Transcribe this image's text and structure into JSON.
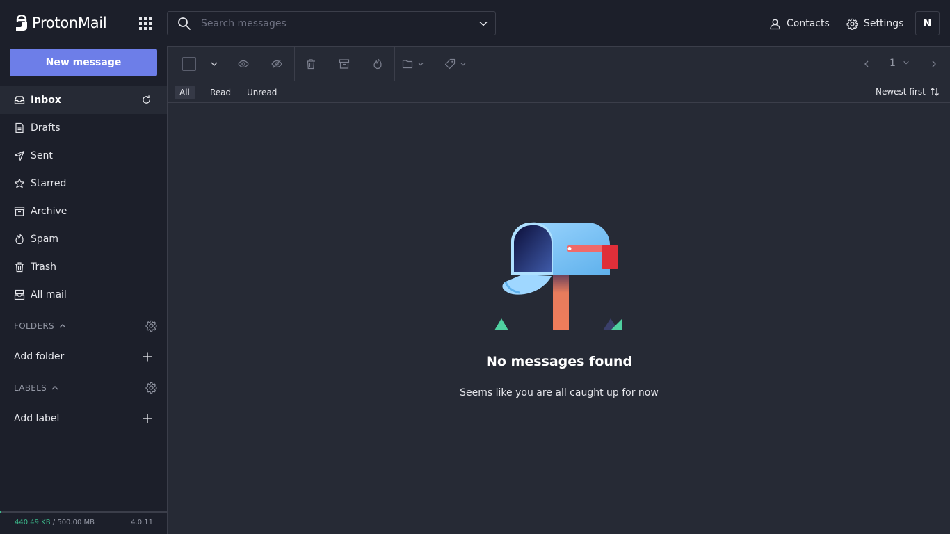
{
  "app": {
    "logo_text": "ProtonMail"
  },
  "search": {
    "placeholder": "Search messages"
  },
  "header": {
    "contacts_label": "Contacts",
    "settings_label": "Settings",
    "avatar_initial": "N"
  },
  "sidebar": {
    "new_message_label": "New message",
    "items": [
      {
        "label": "Inbox",
        "icon": "inbox-icon",
        "active": true
      },
      {
        "label": "Drafts",
        "icon": "drafts-icon"
      },
      {
        "label": "Sent",
        "icon": "paper-plane-icon"
      },
      {
        "label": "Starred",
        "icon": "star-icon"
      },
      {
        "label": "Archive",
        "icon": "archive-icon"
      },
      {
        "label": "Spam",
        "icon": "fire-icon"
      },
      {
        "label": "Trash",
        "icon": "trash-icon"
      },
      {
        "label": "All mail",
        "icon": "all-mail-icon"
      }
    ],
    "folders_label": "FOLDERS",
    "add_folder_label": "Add folder",
    "labels_label": "LABELS",
    "add_label_label": "Add label",
    "storage_used": "440.49 KB",
    "storage_total": "/ 500.00 MB",
    "storage_fraction": 0.0009,
    "version": "4.0.11"
  },
  "toolbar": {
    "page_number": "1"
  },
  "filters": {
    "all": "All",
    "read": "Read",
    "unread": "Unread",
    "sort_label": "Newest first"
  },
  "empty_state": {
    "title": "No messages found",
    "subtitle": "Seems like you are all caught up for now"
  },
  "colors": {
    "accent": "#6d7ee8",
    "background": "#1c1f2a",
    "panel": "#262a35",
    "storage_green": "#3cbb8c"
  }
}
